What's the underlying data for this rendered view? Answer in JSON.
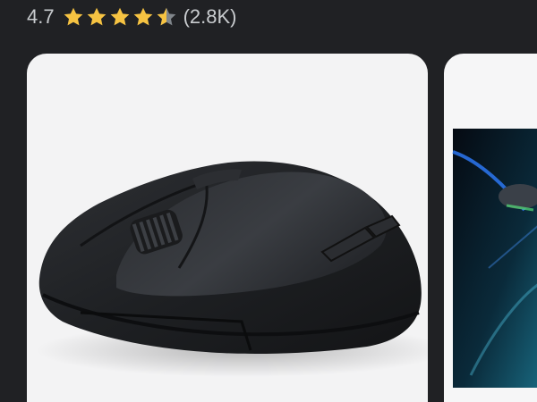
{
  "rating": {
    "value": "4.7",
    "stars_filled": 4.5,
    "stars_total": 5,
    "count": "(2.8K)",
    "star_color": "#f6c342",
    "star_empty_color": "#80868b"
  },
  "gallery": {
    "items": [
      {
        "icon": "mouse-product-image"
      },
      {
        "icon": "mouse-lifestyle-image"
      }
    ]
  }
}
